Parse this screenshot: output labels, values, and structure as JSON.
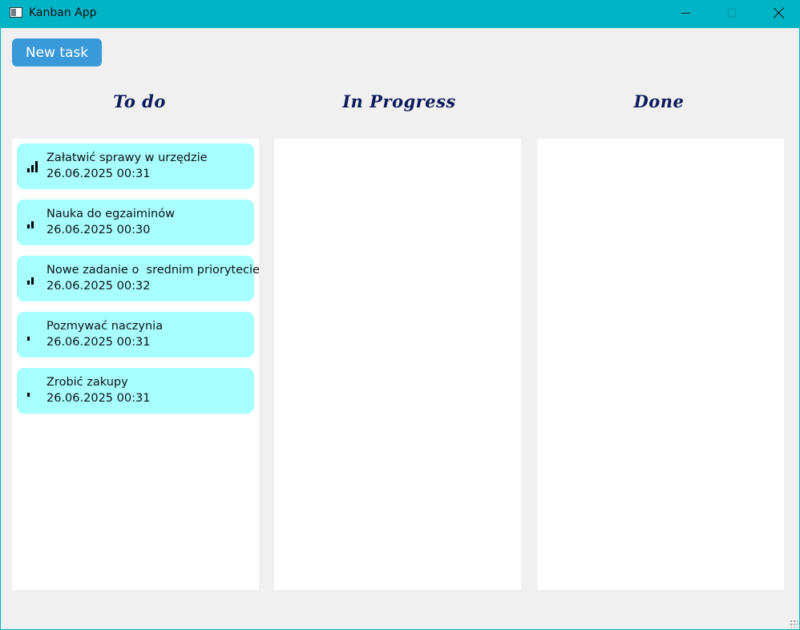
{
  "window": {
    "title": "Kanban App",
    "accent": "#00b4c6",
    "controls": [
      "minimize-icon",
      "maximize-icon",
      "close-icon"
    ]
  },
  "toolbar": {
    "new_task_label": "New task",
    "button_color": "#3a9ad9"
  },
  "columns": [
    {
      "title": "To do"
    },
    {
      "title": "In Progress"
    },
    {
      "title": "Done"
    }
  ],
  "tasks": [
    {
      "title": "Załatwić sprawy w urzędzie",
      "date": "26.06.2025 00:31",
      "priority": "high",
      "icon": "priority-high-icon"
    },
    {
      "title": "Nauka do egzaiminów",
      "date": "26.06.2025 00:30",
      "priority": "medium",
      "icon": "priority-medium-icon"
    },
    {
      "title": "Nowe zadanie o  srednim priorytecie",
      "date": "26.06.2025 00:32",
      "priority": "medium",
      "icon": "priority-medium-icon"
    },
    {
      "title": "Pozmywać naczynia",
      "date": "26.06.2025 00:31",
      "priority": "low",
      "icon": "priority-low-icon"
    },
    {
      "title": "Zrobić zakupy",
      "date": "26.06.2025 00:31",
      "priority": "low",
      "icon": "priority-low-icon"
    }
  ],
  "colors": {
    "card": "#a8ffff",
    "column_title": "#0d1b5a",
    "board_background": "#f0f0f0",
    "column_background": "#ffffff"
  }
}
